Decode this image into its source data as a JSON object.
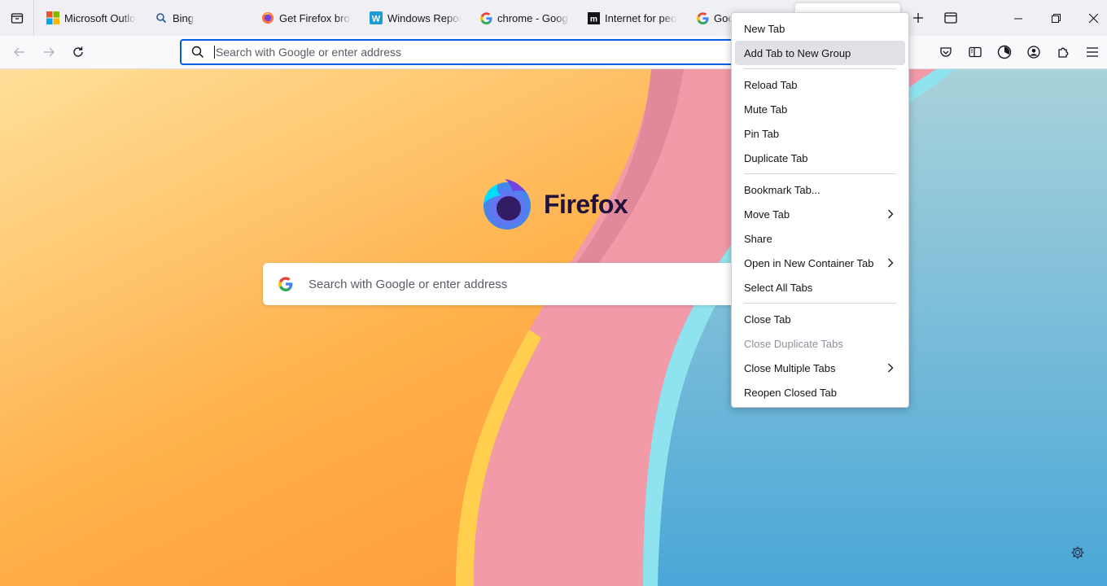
{
  "tabs": [
    {
      "label": "Microsoft Outlook",
      "icon": "microsoft-icon"
    },
    {
      "label": "Bing",
      "icon": "bing-search-icon"
    },
    {
      "label": "Get Firefox browser",
      "icon": "firefox-icon"
    },
    {
      "label": "Windows Report",
      "icon": "windows-report-icon"
    },
    {
      "label": "chrome - Google",
      "icon": "google-icon"
    },
    {
      "label": "Internet for people",
      "icon": "mozilla-icon"
    },
    {
      "label": "Goo",
      "icon": "google-icon"
    }
  ],
  "urlbar": {
    "placeholder": "Search with Google or enter address"
  },
  "newtab": {
    "brand": "Firefox",
    "search_placeholder": "Search with Google or enter address"
  },
  "context_menu": {
    "items": [
      {
        "label": "New Tab"
      },
      {
        "label": "Add Tab to New Group",
        "highlighted": true
      },
      {
        "label": "Reload Tab"
      },
      {
        "label": "Mute Tab"
      },
      {
        "label": "Pin Tab"
      },
      {
        "label": "Duplicate Tab"
      },
      {
        "label": "Bookmark Tab..."
      },
      {
        "label": "Move Tab",
        "submenu": true
      },
      {
        "label": "Share"
      },
      {
        "label": "Open in New Container Tab",
        "submenu": true
      },
      {
        "label": "Select All Tabs"
      },
      {
        "label": "Close Tab"
      },
      {
        "label": "Close Duplicate Tabs",
        "disabled": true
      },
      {
        "label": "Close Multiple Tabs",
        "submenu": true
      },
      {
        "label": "Reopen Closed Tab"
      }
    ]
  },
  "colors": {
    "accent": "#0061e0",
    "menu_highlight": "#e0e0e6",
    "disabled_text": "#8f8f9d"
  }
}
